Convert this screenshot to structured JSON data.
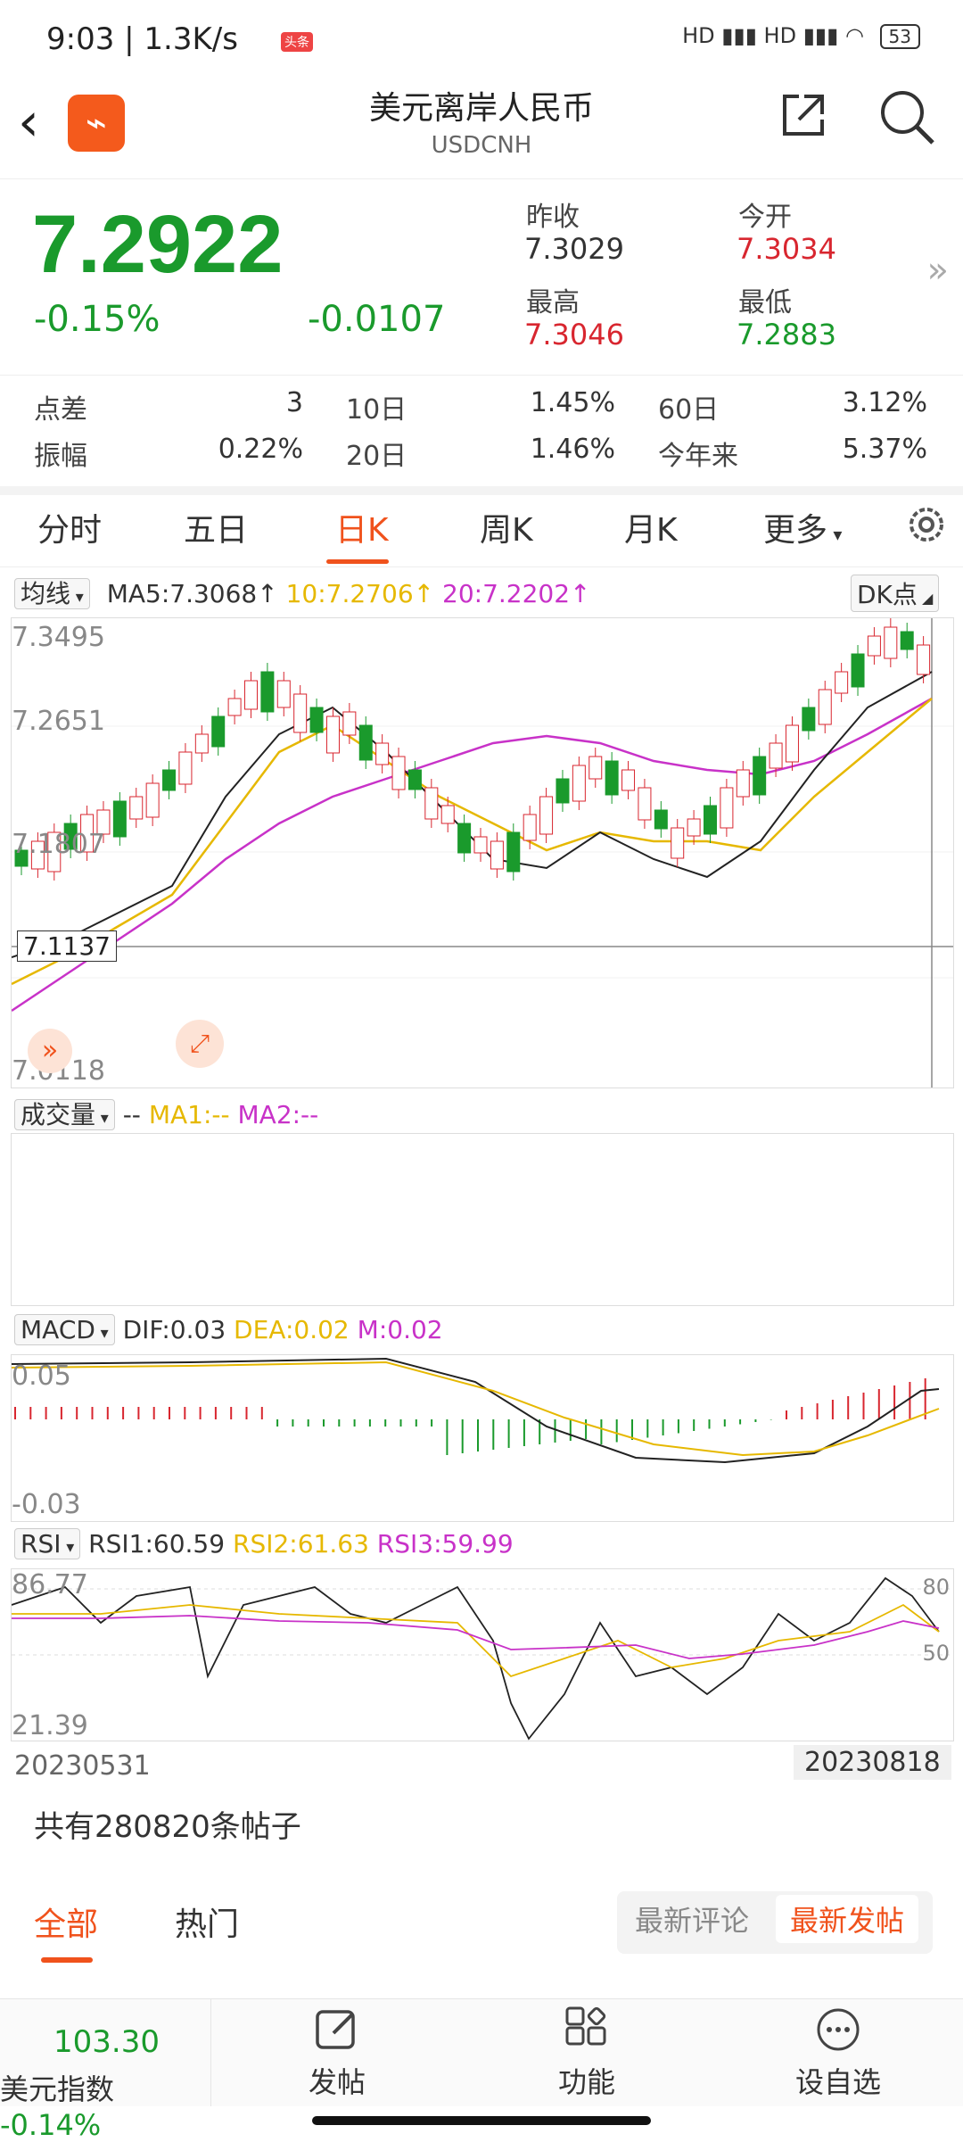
{
  "status": {
    "time": "9:03 | 1.3K/s",
    "badge": "头条",
    "signal": "HD ▮▮▮ HD ▮▮▮",
    "battery": "53"
  },
  "header": {
    "title": "美元离岸人民币",
    "subtitle": "USDCNH"
  },
  "quote": {
    "price": "7.2922",
    "change_pct": "-0.15%",
    "change_abs": "-0.0107",
    "prev_close_label": "昨收",
    "prev_close": "7.3029",
    "open_label": "今开",
    "open": "7.3034",
    "high_label": "最高",
    "high": "7.3046",
    "low_label": "最低",
    "low": "7.2883"
  },
  "stats": [
    {
      "label": "点差",
      "value": "3"
    },
    {
      "label": "10日",
      "value": "1.45%"
    },
    {
      "label": "60日",
      "value": "3.12%"
    },
    {
      "label": "振幅",
      "value": "0.22%"
    },
    {
      "label": "20日",
      "value": "1.46%"
    },
    {
      "label": "今年来",
      "value": "5.37%"
    }
  ],
  "tabs": [
    "分时",
    "五日",
    "日K",
    "周K",
    "月K",
    "更多"
  ],
  "active_tab": "日K",
  "kline": {
    "indicator_select": "均线",
    "ma5": "MA5:7.3068↑",
    "ma10": "10:7.2706↑",
    "ma20": "20:7.2202↑",
    "dk_button": "DK点",
    "y_labels": [
      "7.3495",
      "7.2651",
      "7.1807",
      "7.0118"
    ],
    "cross_value": "7.1137"
  },
  "volume": {
    "select": "成交量",
    "dash": "--",
    "ma1": "MA1:--",
    "ma2": "MA2:--"
  },
  "macd": {
    "select": "MACD",
    "dif": "DIF:0.03",
    "dea": "DEA:0.02",
    "m": "M:0.02",
    "top": "0.05",
    "bottom": "-0.03"
  },
  "rsi": {
    "select": "RSI",
    "rsi1": "RSI1:60.59",
    "rsi2": "RSI2:61.63",
    "rsi3": "RSI3:59.99",
    "top": "86.77",
    "bottom": "21.39",
    "r80": "80",
    "r50": "50"
  },
  "dates": {
    "start": "20230531",
    "end": "20230818"
  },
  "comments": {
    "count_text": "共有280820条帖子",
    "tab_all": "全部",
    "tab_hot": "热门",
    "sort_comment": "最新评论",
    "sort_post": "最新发帖"
  },
  "bottom": {
    "index_value": "103.30",
    "index_name": "美元指数",
    "index_change": "-0.14%",
    "post": "发帖",
    "function": "功能",
    "watch": "设自选"
  },
  "colors": {
    "up": "#d8262f",
    "down": "#1a9a2c",
    "accent": "#f0521c",
    "ma10": "#e6b800",
    "ma20": "#c832c8"
  }
}
